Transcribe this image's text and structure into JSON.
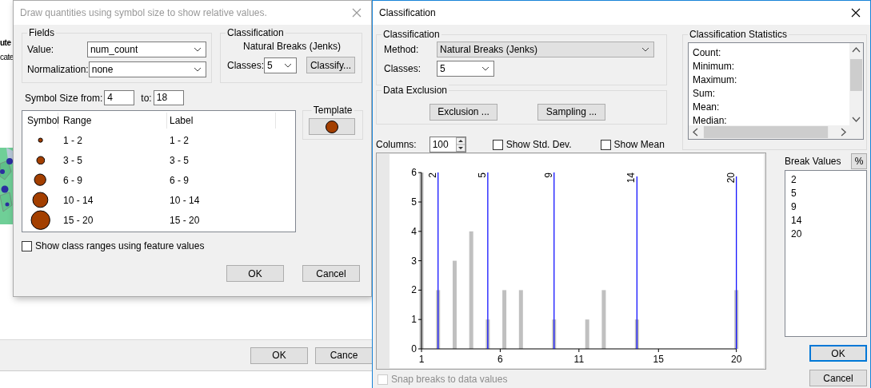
{
  "background_window": {
    "texts": [
      "ute",
      "cate"
    ],
    "buttons": [
      "OK",
      "Cance"
    ]
  },
  "symbol_dialog": {
    "title": "Draw quantities using symbol size to show relative values.",
    "fields": {
      "label": "Fields",
      "value_label": "Value:",
      "value": "num_count",
      "normalization_label": "Normalization:",
      "normalization": "none"
    },
    "classification": {
      "label": "Classification",
      "method": "Natural Breaks (Jenks)",
      "classes_label": "Classes:",
      "classes": "5",
      "classify_button": "Classify..."
    },
    "symbol_size": {
      "from_label": "Symbol Size from:",
      "from": "4",
      "to_label": "to:",
      "to": "18"
    },
    "table": {
      "columns": [
        "Symbol",
        "Range",
        "Label"
      ],
      "rows": [
        {
          "range": "1 - 2",
          "label": "1 - 2"
        },
        {
          "range": "3 - 5",
          "label": "3 - 5"
        },
        {
          "range": "6 - 9",
          "label": "6 - 9"
        },
        {
          "range": "10 - 14",
          "label": "10 - 14"
        },
        {
          "range": "15 - 20",
          "label": "15 - 20"
        }
      ]
    },
    "template": {
      "label": "Template"
    },
    "show_class_ranges": {
      "label": "Show class ranges using feature values",
      "checked": false
    },
    "buttons": [
      "OK",
      "Cancel"
    ]
  },
  "classification_dialog": {
    "title": "Classification",
    "classification": {
      "label": "Classification",
      "method_label": "Method:",
      "method": "Natural Breaks (Jenks)",
      "classes_label": "Classes:",
      "classes": "5"
    },
    "data_exclusion": {
      "label": "Data Exclusion",
      "buttons": [
        "Exclusion ...",
        "Sampling ..."
      ]
    },
    "statistics": {
      "label": "Classification Statistics",
      "items": [
        "Count:",
        "Minimum:",
        "Maximum:",
        "Sum:",
        "Mean:",
        "Median:"
      ]
    },
    "columns": {
      "label": "Columns:",
      "value": "100"
    },
    "options": [
      {
        "label": "Show Std. Dev.",
        "checked": false
      },
      {
        "label": "Show Mean",
        "checked": false
      }
    ],
    "chart_data": {
      "type": "bar",
      "x": [
        1,
        2,
        3,
        4,
        5,
        6,
        7,
        9,
        11,
        12,
        14,
        20
      ],
      "values": [
        6,
        2,
        3,
        4,
        1,
        2,
        2,
        1,
        1,
        2,
        1,
        2
      ],
      "xlim": [
        1,
        20
      ],
      "ylim": [
        0,
        6
      ],
      "xticks": [
        {
          "value": 1,
          "label": "1"
        },
        {
          "value": 5.75,
          "label": "6"
        },
        {
          "value": 10.5,
          "label": "11"
        },
        {
          "value": 15.3,
          "label": "15"
        },
        {
          "value": 20,
          "label": "20"
        }
      ],
      "yticks": [
        0,
        1,
        2,
        3,
        4,
        5,
        6
      ],
      "ref_lines": [
        {
          "axis": "x",
          "value": 2,
          "label": "2"
        },
        {
          "axis": "x",
          "value": 5,
          "label": "5"
        },
        {
          "axis": "x",
          "value": 9,
          "label": "9"
        },
        {
          "axis": "x",
          "value": 14,
          "label": "14"
        },
        {
          "axis": "x",
          "value": 20,
          "label": "20"
        }
      ]
    },
    "break_values": {
      "label": "Break Values",
      "percent_button": "%",
      "values": [
        "2",
        "5",
        "9",
        "14",
        "20"
      ]
    },
    "snap_breaks": {
      "label": "Snap breaks to data values",
      "checked": false,
      "disabled": true
    },
    "buttons": [
      "OK",
      "Cancel"
    ]
  }
}
